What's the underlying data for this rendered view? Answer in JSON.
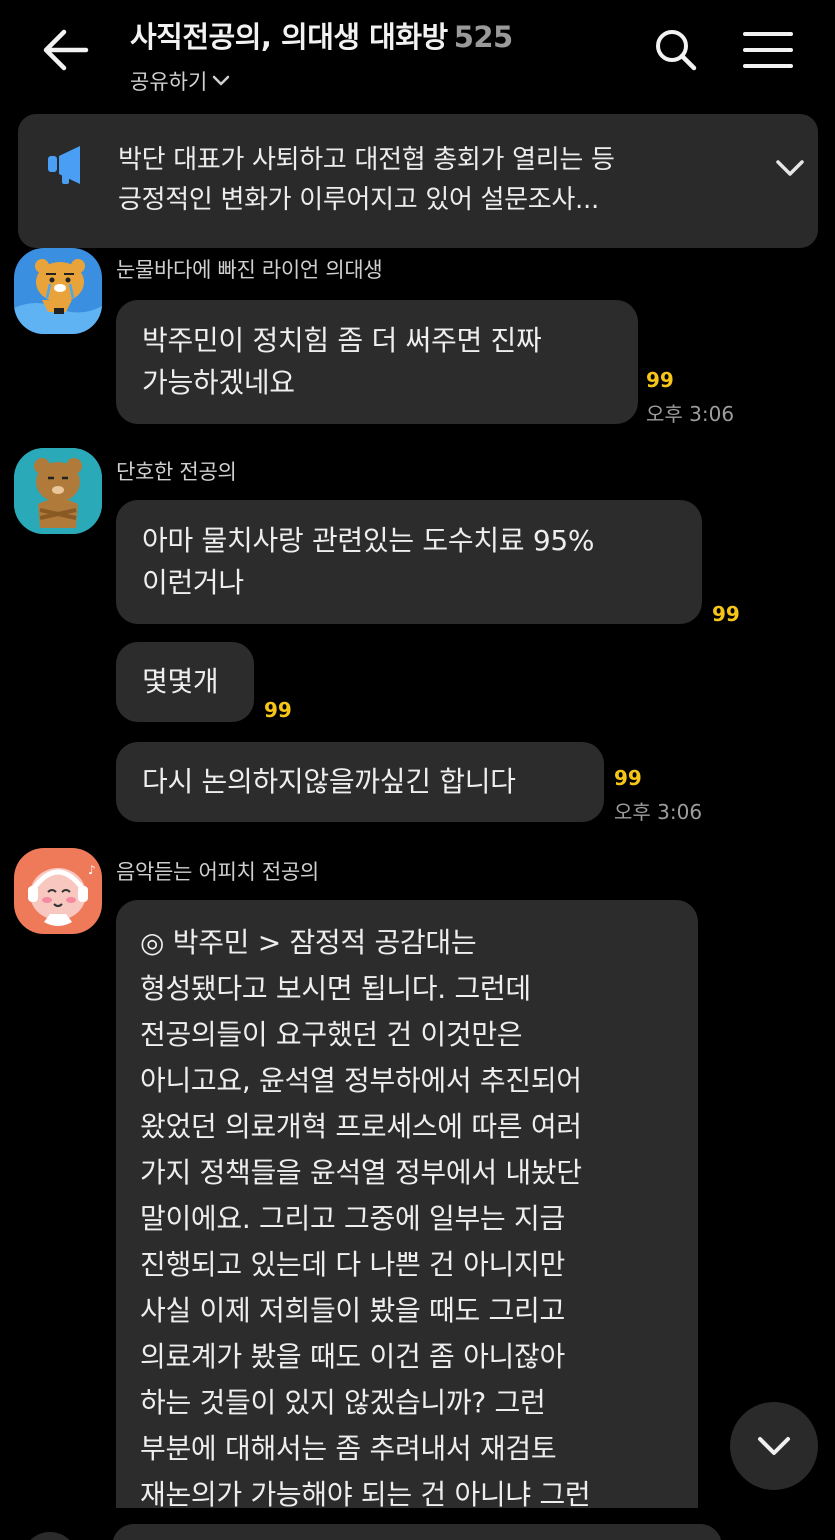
{
  "header": {
    "title": "사직전공의, 의대생 대화방",
    "member_count": "525",
    "share_label": "공유하기"
  },
  "notice": {
    "text_line1": "박단 대표가 사퇴하고 대전협 총회가 열리는 등",
    "text_line2": "긍정적인 변화가 이루어지고 있어 설문조사..."
  },
  "messages": [
    {
      "sender": "눈물바다에 빠진 라이언 의대생",
      "text_line1": "박주민이 정치힘 좀 더 써주면 진짜",
      "text_line2": "가능하겠네요",
      "unread": "99",
      "time": "오후 3:06"
    },
    {
      "sender": "단호한 전공의",
      "text_line1": "아마 물치사랑 관련있는 도수치료 95%",
      "text_line2": "이런거나",
      "unread": "99"
    },
    {
      "text": "몇몇개",
      "unread": "99"
    },
    {
      "text": "다시 논의하지않을까싶긴 합니다",
      "unread": "99",
      "time": "오후 3:06"
    },
    {
      "sender": "음악듣는 어피치 전공의",
      "lines": [
        "◎ 박주민 > 잠정적 공감대는",
        "형성됐다고 보시면 됩니다. 그런데",
        "전공의들이 요구했던 건 이것만은",
        "아니고요, 윤석열 정부하에서 추진되어",
        "왔었던 의료개혁 프로세스에 따른 여러",
        "가지 정책들을 윤석열 정부에서 내놨단",
        "말이에요. 그리고 그중에 일부는 지금",
        "진행되고 있는데 다 나쁜 건 아니지만",
        "사실 이제 저희들이 봤을 때도 그리고",
        "의료계가 봤을 때도 이건 좀 아니잖아",
        "하는 것들이 있지 않겠습니까? 그런",
        "부분에 대해서는 좀 추려내서 재검토",
        "재논의가 가능해야 되는 건 아니냐 그런"
      ]
    }
  ]
}
